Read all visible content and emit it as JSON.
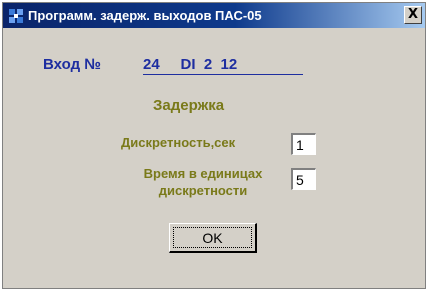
{
  "window": {
    "title": "Программ. задерж. выходов ПАС-05",
    "close_label": "X"
  },
  "input": {
    "label": "Вход №",
    "value": "24     DI  2  12"
  },
  "delay": {
    "title": "Задержка",
    "discreteness_label": "Дискретность,сек",
    "discreteness_value": "1",
    "time_label_line1": "Время в единицах",
    "time_label_line2": "дискретности",
    "time_value": "5"
  },
  "buttons": {
    "ok_label": "OK"
  },
  "colors": {
    "title_gradient_start": "#0a246a",
    "title_gradient_end": "#a6caf0",
    "input_text": "#1e2ea0",
    "label_text": "#7a7a1a",
    "window_bg": "#d4d0c8"
  },
  "icons": {
    "app": "app-icon",
    "close": "close-icon"
  }
}
